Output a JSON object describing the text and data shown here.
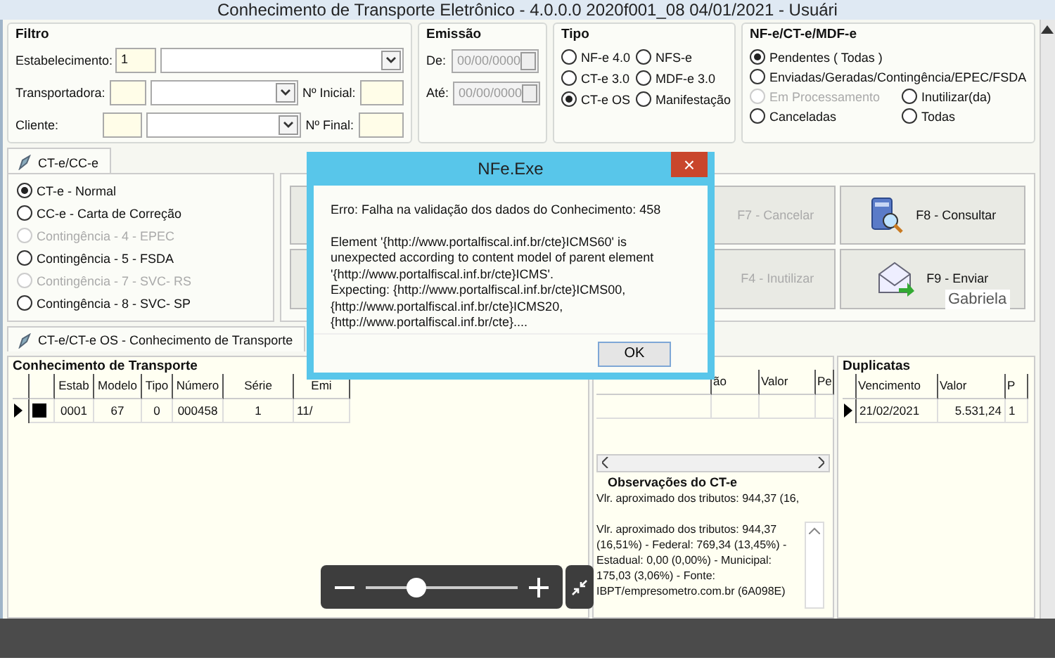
{
  "window": {
    "title": "Conhecimento de Transporte Eletrônico - 4.0.0.0 2020f001_08 04/01/2021 - Usuári"
  },
  "filter": {
    "title": "Filtro",
    "rows": [
      {
        "label": "Estabelecimento:",
        "code": "1"
      },
      {
        "label": "Transportadora:",
        "extra_label": "Nº Inicial:"
      },
      {
        "label": "Cliente:",
        "extra_label": "Nº Final:"
      }
    ]
  },
  "emission": {
    "title": "Emissão",
    "fields": [
      {
        "label": "De:",
        "value": "00/00/0000"
      },
      {
        "label": "Até:",
        "value": "00/00/0000"
      }
    ]
  },
  "type": {
    "title": "Tipo",
    "options": [
      {
        "label": "NF-e 4.0",
        "selected": false
      },
      {
        "label": "NFS-e",
        "selected": false
      },
      {
        "label": "CT-e 3.0",
        "selected": false
      },
      {
        "label": "MDF-e 3.0",
        "selected": false
      },
      {
        "label": "CT-e OS",
        "selected": true
      },
      {
        "label": "Manifestação",
        "selected": false
      }
    ]
  },
  "status": {
    "title": "NF-e/CT-e/MDF-e",
    "options": [
      {
        "label": "Pendentes ( Todas )",
        "selected": true,
        "disabled": false
      },
      {
        "label": "Enviadas/Geradas/Contingência/EPEC/FSDA",
        "selected": false,
        "disabled": false
      },
      {
        "label": "Em Processamento",
        "selected": false,
        "disabled": true
      },
      {
        "label": "Inutilizar(da)",
        "selected": false,
        "disabled": false
      },
      {
        "label": "Canceladas",
        "selected": false,
        "disabled": false
      },
      {
        "label": "Todas",
        "selected": false,
        "disabled": false
      }
    ]
  },
  "cte_tab": {
    "label": "CT-e/CC-e",
    "options": [
      {
        "label": "CT-e - Normal",
        "selected": true,
        "disabled": false
      },
      {
        "label": "CC-e - Carta de Correção",
        "selected": false,
        "disabled": false
      },
      {
        "label": "Contingência - 4 - EPEC",
        "selected": false,
        "disabled": true
      },
      {
        "label": "Contingência - 5 - FSDA",
        "selected": false,
        "disabled": false
      },
      {
        "label": "Contingência - 7 - SVC- RS",
        "selected": false,
        "disabled": true
      },
      {
        "label": "Contingência - 8 - SVC- SP",
        "selected": false,
        "disabled": false
      }
    ]
  },
  "actions": [
    {
      "label": "F7 - Cancelar",
      "disabled": true
    },
    {
      "label": "F8 - Consultar",
      "disabled": false,
      "kind": "query"
    },
    {
      "label": "F4 - Inutilizar",
      "disabled": true
    },
    {
      "label": "F9 - Enviar",
      "disabled": false,
      "kind": "send"
    }
  ],
  "tooltip": "Gabriela",
  "bottom_tab": {
    "label": "CT-e/CT-e OS - Conhecimento de Transporte",
    "selected": true
  },
  "transport_grid": {
    "title": "Conhecimento de Transporte",
    "columns": [
      "Estab",
      "Modelo",
      "Tipo",
      "Número",
      "Série",
      "Emi"
    ],
    "rows": [
      {
        "selected": true,
        "cells": [
          "0001",
          "67",
          "0",
          "000458",
          "1",
          "11/"
        ]
      }
    ]
  },
  "detail_grid": {
    "columns": [
      "ão",
      "Valor",
      "Pe"
    ]
  },
  "observations": {
    "title": "Observações do CT-e",
    "summary": "Vlr. aproximado dos tributos: 944,37 (16,",
    "memo": "Vlr. aproximado dos tributos: 944,37 (16,51%) - Federal: 769,34 (13,45%) - Estadual: 0,00 (0,00%) - Municipal: 175,03 (3,06%) - Fonte: IBPT/empresometro.com.br (6A098E)"
  },
  "duplicates": {
    "title": "Duplicatas",
    "columns": [
      "Vencimento",
      "Valor",
      "P"
    ],
    "rows": [
      {
        "selected": true,
        "cells": [
          "21/02/2021",
          "5.531,24",
          "1"
        ]
      }
    ]
  },
  "dialog": {
    "title": "NFe.Exe",
    "close": "×",
    "error": "Erro: Falha na validação dos dados do Conhecimento: 458",
    "detail_lines": [
      "Element '{http://www.portalfiscal.inf.br/cte}ICMS60' is",
      "unexpected according to content model of parent element",
      "'{http://www.portalfiscal.inf.br/cte}ICMS'.",
      "Expecting: {http://www.portalfiscal.inf.br/cte}ICMS00,",
      "{http://www.portalfiscal.inf.br/cte}ICMS20,",
      "{http://www.portalfiscal.inf.br/cte}...."
    ],
    "button": "OK"
  },
  "zoom_control": {
    "level": 0.33
  }
}
